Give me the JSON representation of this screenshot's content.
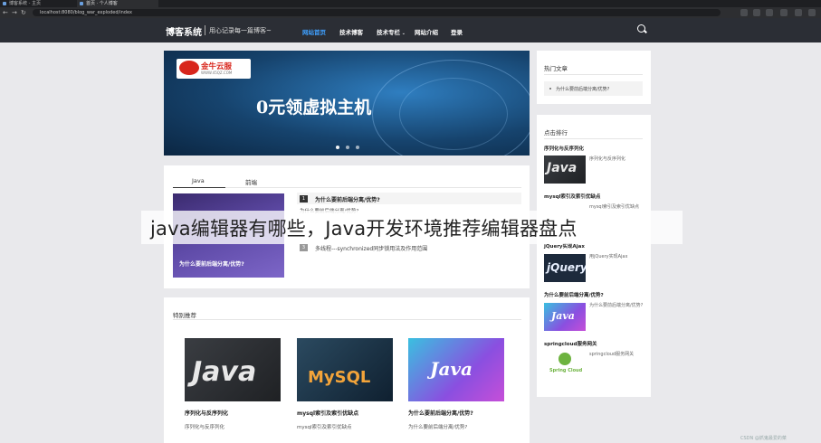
{
  "browser": {
    "tabs": [
      "博客系统 - 主页",
      "首页 · 个人博客"
    ],
    "url": "localhost:8080/blog_war_exploded/index"
  },
  "site": {
    "brand": "博客系统",
    "slogan": "用心记录每一篇博客~",
    "nav": [
      {
        "label": "网站首页",
        "active": true
      },
      {
        "label": "技术博客",
        "active": false
      },
      {
        "label": "技术专栏",
        "active": false,
        "dropdown": true
      },
      {
        "label": "网站介绍",
        "active": false
      },
      {
        "label": "登录",
        "active": false
      }
    ],
    "search_icon": "search-icon"
  },
  "banner": {
    "logo_name": "金牛云服",
    "logo_url": "WWW.45QZ.COM",
    "headline": "0元领虚拟主机",
    "slides": 3,
    "active_slide": 1
  },
  "tabs_card": {
    "tabs": [
      {
        "label": "Java",
        "active": true
      },
      {
        "label": "前端",
        "active": false
      }
    ],
    "thumb_caption": "为什么要前后端分离/优势?",
    "articles": [
      {
        "num": "1",
        "title": "为什么要前后端分离/优势?",
        "sub": "为什么要前后端分离/优势?"
      },
      {
        "num": "3",
        "title": "多线程---synchronized同步锁用法及作用范围"
      }
    ]
  },
  "featured": {
    "heading": "特别推荐",
    "items": [
      {
        "title": "序列化与反序列化",
        "desc": "序列化与反序列化",
        "image": "Java"
      },
      {
        "title": "mysql索引及索引优缺点",
        "desc": "mysql索引及索引优缺点",
        "image": "MySQL"
      },
      {
        "title": "为什么要前后端分离/优势?",
        "desc": "为什么要前后端分离/优势?",
        "image": "Java"
      }
    ]
  },
  "sidebar": {
    "hot_heading": "热门文章",
    "hot_items": [
      "为什么要前后端分离/优势?"
    ],
    "rank_heading": "点击排行",
    "rank_items": [
      {
        "title": "序列化与反序列化",
        "desc": "序列化与反序列化",
        "image": "Java"
      },
      {
        "title": "mysql索引及索引优缺点",
        "desc": "mysql索引及索引优缺点"
      },
      {
        "title": "jQuery实现Ajax",
        "desc": "用jQuery实现Ajax",
        "image": "jQuery"
      },
      {
        "title": "为什么要前后端分离/优势?",
        "desc": "为什么要前后端分离/优势?",
        "image": "Java"
      },
      {
        "title": "springcloud服务网关",
        "desc": "springcloud服务网关",
        "image": "Spring Cloud"
      }
    ]
  },
  "overlay": {
    "caption": "java编辑器有哪些，Java开发环境推荐编辑器盘点",
    "watermark": "CSDN @抓鬼最爱的菜"
  },
  "colors": {
    "nav_bg": "#2b2e35",
    "nav_active": "#3fa0ff",
    "page_bg": "#e9e9ec"
  }
}
